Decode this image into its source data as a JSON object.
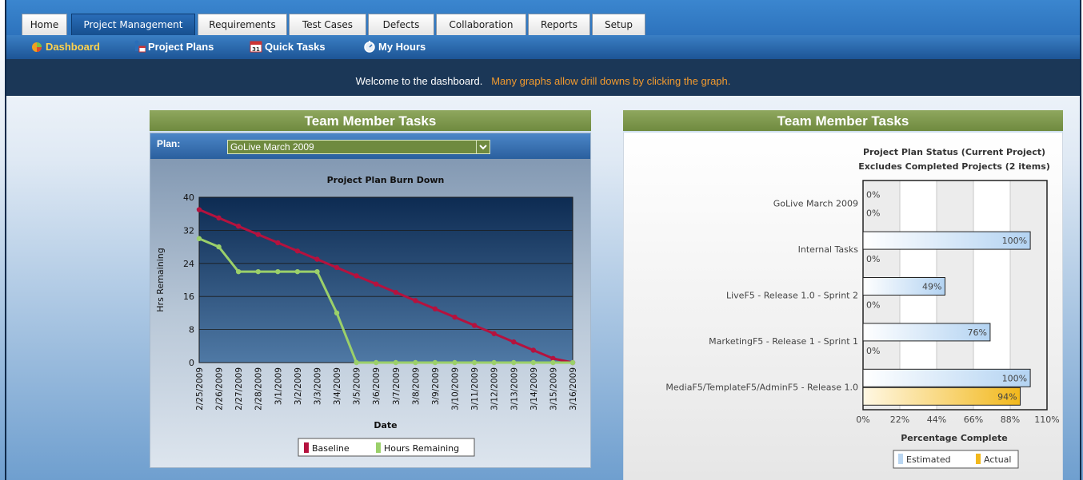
{
  "tabs": [
    {
      "label": "Home",
      "active": false
    },
    {
      "label": "Project Management",
      "active": true
    },
    {
      "label": "Requirements",
      "active": false
    },
    {
      "label": "Test Cases",
      "active": false
    },
    {
      "label": "Defects",
      "active": false
    },
    {
      "label": "Collaboration",
      "active": false
    },
    {
      "label": "Reports",
      "active": false
    },
    {
      "label": "Setup",
      "active": false
    }
  ],
  "subnav": [
    {
      "label": "Dashboard",
      "icon": "dashboard-icon",
      "active": true
    },
    {
      "label": "Project Plans",
      "icon": "project-plans-icon",
      "active": false
    },
    {
      "label": "Quick Tasks",
      "icon": "calendar-icon",
      "active": false
    },
    {
      "label": "My Hours",
      "icon": "stopwatch-icon",
      "active": false
    }
  ],
  "welcome": {
    "text": "Welcome to the dashboard.",
    "highlight": "Many graphs allow drill downs by clicking the graph."
  },
  "panel_left": {
    "title": "Team Member Tasks",
    "plan_label": "Plan:",
    "plan_value": "GoLive March 2009"
  },
  "panel_right": {
    "title": "Team Member Tasks"
  },
  "colors": {
    "accent_green": "#7a9448",
    "baseline": "#b5123e",
    "hours_remaining": "#9bd06a",
    "estimated": "#b9d6f2",
    "actual": "#f2b81c",
    "welcome_highlight": "#f29a2e"
  },
  "chart_data": [
    {
      "type": "line",
      "title": "Project Plan Burn Down",
      "xlabel": "Date",
      "ylabel": "Hrs Remaining",
      "ylim": [
        0,
        40
      ],
      "yticks": [
        "0",
        "8",
        "16",
        "24",
        "32",
        "40"
      ],
      "categories": [
        "2/25/2009",
        "2/26/2009",
        "2/27/2009",
        "2/28/2009",
        "3/1/2009",
        "3/2/2009",
        "3/3/2009",
        "3/4/2009",
        "3/5/2009",
        "3/6/2009",
        "3/7/2009",
        "3/8/2009",
        "3/9/2009",
        "3/10/2009",
        "3/11/2009",
        "3/12/2009",
        "3/13/2009",
        "3/14/2009",
        "3/15/2009",
        "3/16/2009"
      ],
      "series": [
        {
          "name": "Baseline",
          "values": [
            37,
            35,
            33,
            31,
            29,
            27,
            25,
            23,
            21,
            19,
            17,
            15,
            13,
            11,
            9,
            7,
            5,
            3,
            1,
            0
          ]
        },
        {
          "name": "Hours Remaining",
          "values": [
            30,
            28,
            22,
            22,
            22,
            22,
            22,
            12,
            0,
            0,
            0,
            0,
            0,
            0,
            0,
            0,
            0,
            0,
            0,
            0
          ]
        }
      ],
      "grid": true,
      "legend": "bottom"
    },
    {
      "type": "bar",
      "orientation": "horizontal",
      "title": "Project Plan Status (Current Project)",
      "subtitle": "Excludes Completed Projects (2 items)",
      "xlabel": "Percentage Complete",
      "xlim": [
        0,
        110
      ],
      "xticks": [
        "0%",
        "22%",
        "44%",
        "66%",
        "88%",
        "110%"
      ],
      "categories": [
        "GoLive March 2009",
        "Internal Tasks",
        "LiveF5 - Release 1.0 - Sprint 2",
        "MarketingF5 - Release 1 - Sprint 1",
        "MediaF5/TemplateF5/AdminF5 - Release 1.0"
      ],
      "series": [
        {
          "name": "Estimated",
          "values": [
            0,
            100,
            49,
            76,
            100
          ]
        },
        {
          "name": "Actual",
          "values": [
            0,
            0,
            0,
            0,
            94
          ]
        }
      ],
      "grid": true,
      "legend": "bottom"
    }
  ]
}
